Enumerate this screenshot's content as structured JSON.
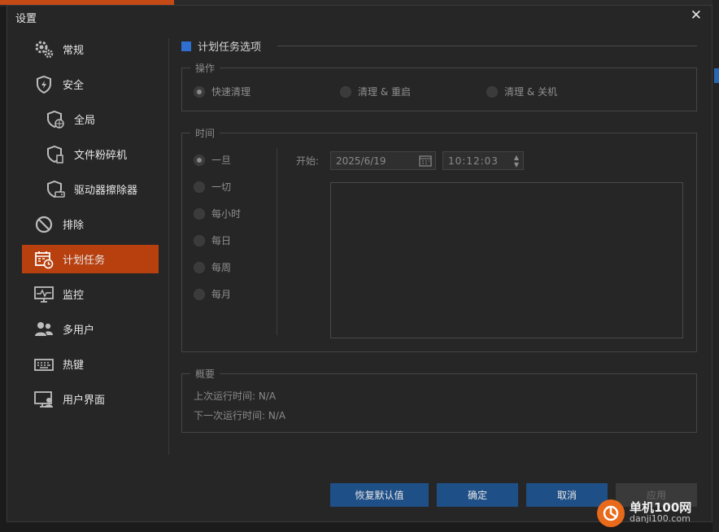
{
  "window": {
    "title": "设置",
    "close_glyph": "✕"
  },
  "sidebar": {
    "items": [
      {
        "label": "常规",
        "icon": "gears-icon"
      },
      {
        "label": "安全",
        "icon": "shield-icon"
      },
      {
        "label": "全局",
        "icon": "shield-globe-icon",
        "sub": true
      },
      {
        "label": "文件粉碎机",
        "icon": "shield-file-icon",
        "sub": true
      },
      {
        "label": "驱动器擦除器",
        "icon": "shield-drive-icon",
        "sub": true
      },
      {
        "label": "排除",
        "icon": "ban-icon"
      },
      {
        "label": "计划任务",
        "icon": "calendar-clock-icon",
        "active": true
      },
      {
        "label": "监控",
        "icon": "monitor-pulse-icon"
      },
      {
        "label": "多用户",
        "icon": "users-icon"
      },
      {
        "label": "热键",
        "icon": "keyboard-icon"
      },
      {
        "label": "用户界面",
        "icon": "monitor-user-icon"
      }
    ]
  },
  "main": {
    "section_title": "计划任务选项",
    "operation": {
      "legend": "操作",
      "options": [
        "快速清理",
        "清理 & 重启",
        "清理 & 关机"
      ],
      "selected": 0
    },
    "time": {
      "legend": "时间",
      "options": [
        "一旦",
        "一切",
        "每小时",
        "每日",
        "每周",
        "每月"
      ],
      "selected": 0,
      "start_label": "开始:",
      "start_date": "2025/6/19",
      "start_time": "10:12:03"
    },
    "summary": {
      "legend": "概要",
      "last_run": "上次运行时间: N/A",
      "next_run": "下一次运行时间: N/A"
    }
  },
  "buttons": {
    "restore": "恢复默认值",
    "ok": "确定",
    "cancel": "取消",
    "apply": "应用"
  },
  "watermark": {
    "brand": "单机100网",
    "url": "danji100.com"
  },
  "colors": {
    "accent": "#b8400f",
    "button": "#1f4f87",
    "section_marker": "#2f6fd0"
  }
}
